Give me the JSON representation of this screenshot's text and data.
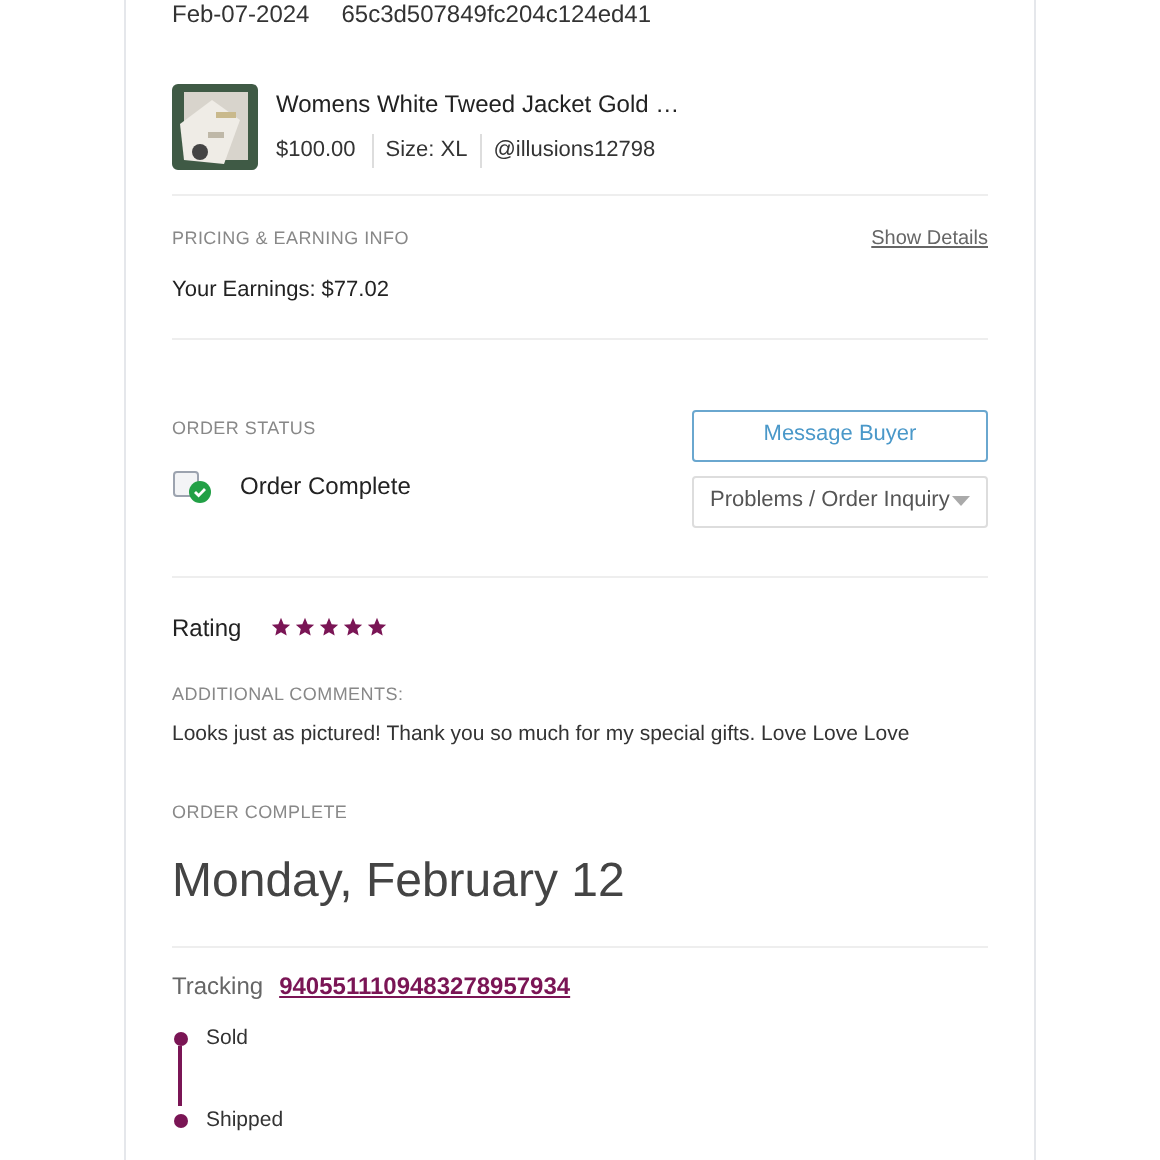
{
  "order": {
    "date": "Feb-07-2024",
    "id": "65c3d507849fc204c124ed41"
  },
  "item": {
    "kind": "picture",
    "title": "Womens White Tweed Jacket Gold …",
    "price": "$100.00",
    "size": "Size: XL",
    "buyer": "@illusions12798"
  },
  "pricing": {
    "label": "PRICING & EARNING INFO",
    "link": "Show Details",
    "earnings": "Your Earnings: $77.02"
  },
  "status": {
    "label": "ORDER STATUS",
    "text": "Order Complete",
    "message_button": "Message Buyer",
    "inquiry_dropdown": "Problems / Order Inquiry"
  },
  "rating": {
    "label": "Rating",
    "stars": 5,
    "comments_label": "ADDITIONAL COMMENTS:",
    "comments": "Looks just as pictured! Thank you so much for my special gifts. Love Love Love"
  },
  "completion": {
    "label": "ORDER COMPLETE",
    "date": "Monday, February 12"
  },
  "tracking": {
    "label": "Tracking",
    "number": "9405511109483278957934"
  },
  "timeline": [
    {
      "label": "Sold"
    },
    {
      "label": "Shipped"
    }
  ]
}
